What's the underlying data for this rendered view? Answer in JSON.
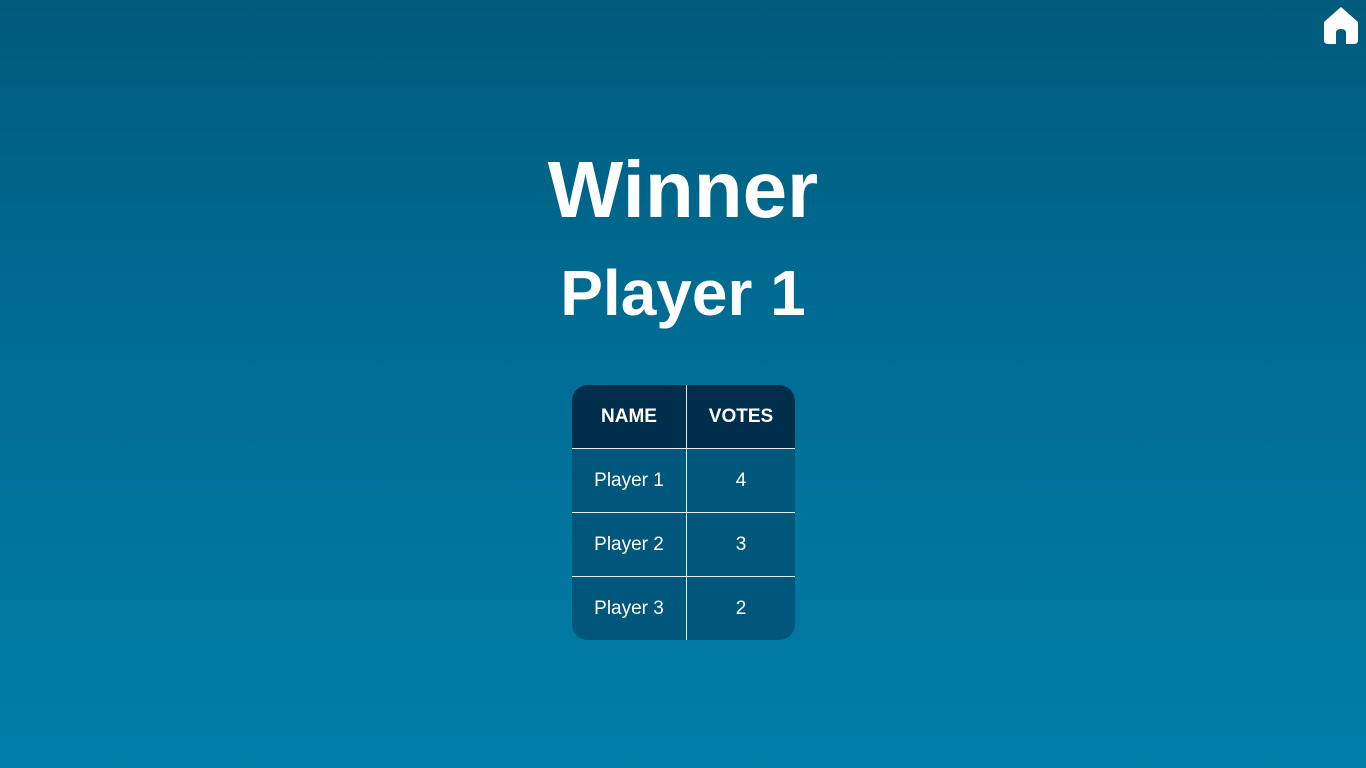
{
  "header": {
    "home_icon": "home-icon"
  },
  "result": {
    "title": "Winner",
    "winner": "Player 1"
  },
  "table": {
    "columns": [
      "NAME",
      "VOTES"
    ],
    "rows": [
      {
        "name": "Player 1",
        "votes": "4"
      },
      {
        "name": "Player 2",
        "votes": "3"
      },
      {
        "name": "Player 3",
        "votes": "2"
      }
    ]
  },
  "colors": {
    "background_top": "#005a7b",
    "background_bottom": "#007ea9",
    "table_header": "#012f4b",
    "table_cell": "#00577b",
    "text": "#ffffff"
  }
}
